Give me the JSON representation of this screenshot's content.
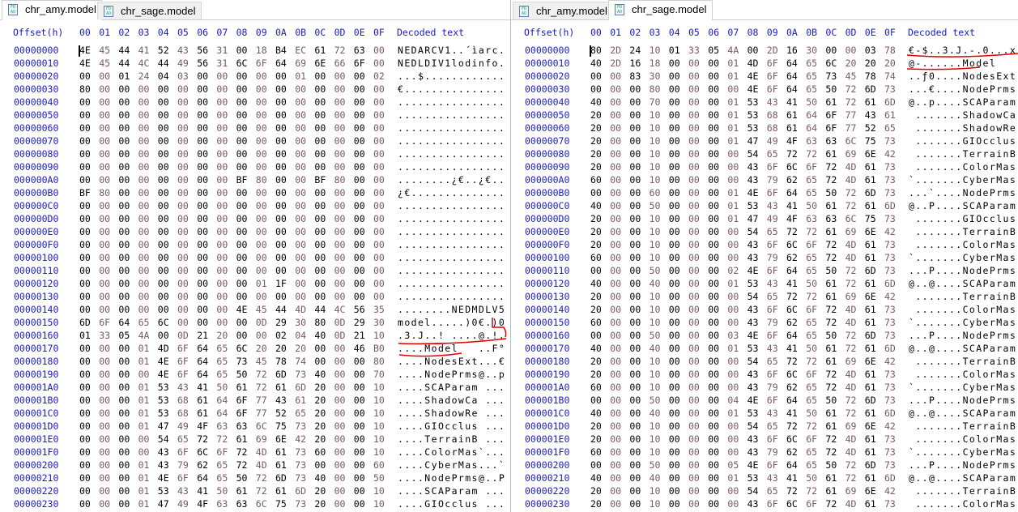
{
  "header": {
    "offset_label": "Offset(h)",
    "columns": [
      "00",
      "01",
      "02",
      "03",
      "04",
      "05",
      "06",
      "07",
      "08",
      "09",
      "0A",
      "0B",
      "0C",
      "0D",
      "0E",
      "0F"
    ],
    "decoded_label": "Decoded text"
  },
  "colors": {
    "offset": "#1a1acc",
    "hex_even": "#000000",
    "hex_odd": "#7a5a5a",
    "annotation": "#e00000"
  },
  "panes": [
    {
      "tabs": [
        {
          "label": "chr_amy.model",
          "active": true,
          "icon": "file-icon"
        },
        {
          "label": "chr_sage.model",
          "active": false,
          "icon": "file-icon"
        }
      ],
      "rows": [
        {
          "offset": "00000000",
          "bytes": "4E 45 44 41 52 43 56 31 00 18 B4 EC 61 72 63 00",
          "text": "NEDARCV1..´ìarc."
        },
        {
          "offset": "00000010",
          "bytes": "4E 45 44 4C 44 49 56 31 6C 6F 64 69 6E 66 6F 00",
          "text": "NEDLDIV1lodinfo."
        },
        {
          "offset": "00000020",
          "bytes": "00 00 01 24 04 03 00 00 00 00 00 01 00 00 00 02",
          "text": "...$............"
        },
        {
          "offset": "00000030",
          "bytes": "80 00 00 00 00 00 00 00 00 00 00 00 00 00 00 00",
          "text": "€..............."
        },
        {
          "offset": "00000040",
          "bytes": "00 00 00 00 00 00 00 00 00 00 00 00 00 00 00 00",
          "text": "................"
        },
        {
          "offset": "00000050",
          "bytes": "00 00 00 00 00 00 00 00 00 00 00 00 00 00 00 00",
          "text": "................"
        },
        {
          "offset": "00000060",
          "bytes": "00 00 00 00 00 00 00 00 00 00 00 00 00 00 00 00",
          "text": "................"
        },
        {
          "offset": "00000070",
          "bytes": "00 00 00 00 00 00 00 00 00 00 00 00 00 00 00 00",
          "text": "................"
        },
        {
          "offset": "00000080",
          "bytes": "00 00 00 00 00 00 00 00 00 00 00 00 00 00 00 00",
          "text": "................"
        },
        {
          "offset": "00000090",
          "bytes": "00 00 00 00 00 00 00 00 00 00 00 00 00 00 00 00",
          "text": "................"
        },
        {
          "offset": "000000A0",
          "bytes": "00 00 00 00 00 00 00 00 BF 80 00 00 BF 80 00 00",
          "text": "........¿€..¿€.."
        },
        {
          "offset": "000000B0",
          "bytes": "BF 80 00 00 00 00 00 00 00 00 00 00 00 00 00 00",
          "text": "¿€.............."
        },
        {
          "offset": "000000C0",
          "bytes": "00 00 00 00 00 00 00 00 00 00 00 00 00 00 00 00",
          "text": "................"
        },
        {
          "offset": "000000D0",
          "bytes": "00 00 00 00 00 00 00 00 00 00 00 00 00 00 00 00",
          "text": "................"
        },
        {
          "offset": "000000E0",
          "bytes": "00 00 00 00 00 00 00 00 00 00 00 00 00 00 00 00",
          "text": "................"
        },
        {
          "offset": "000000F0",
          "bytes": "00 00 00 00 00 00 00 00 00 00 00 00 00 00 00 00",
          "text": "................"
        },
        {
          "offset": "00000100",
          "bytes": "00 00 00 00 00 00 00 00 00 00 00 00 00 00 00 00",
          "text": "................"
        },
        {
          "offset": "00000110",
          "bytes": "00 00 00 00 00 00 00 00 00 00 00 00 00 00 00 00",
          "text": "................"
        },
        {
          "offset": "00000120",
          "bytes": "00 00 00 00 00 00 00 00 00 01 1F 00 00 00 00 00",
          "text": "................"
        },
        {
          "offset": "00000130",
          "bytes": "00 00 00 00 00 00 00 00 00 00 00 00 00 00 00 00",
          "text": "................"
        },
        {
          "offset": "00000140",
          "bytes": "00 00 00 00 00 00 00 00 4E 45 44 4D 44 4C 56 35",
          "text": "........NEDMDLV5"
        },
        {
          "offset": "00000150",
          "bytes": "6D 6F 64 65 6C 00 00 00 00 0D 29 30 80 0D 29 30",
          "text": "model.....)0€.)0"
        },
        {
          "offset": "00000160",
          "bytes": "01 33 05 4A 00 0D 21 20 00 00 02 04 40 0D 21 10",
          "text": ".3.J..! ....@.!."
        },
        {
          "offset": "00000170",
          "bytes": "00 00 00 01 4D 6F 64 65 6C 20 20 20 00 00 46 B0",
          "text": "....Model   ..F°"
        },
        {
          "offset": "00000180",
          "bytes": "00 00 00 01 4E 6F 64 65 73 45 78 74 00 00 00 80",
          "text": "....NodesExt...€"
        },
        {
          "offset": "00000190",
          "bytes": "00 00 00 00 4E 6F 64 65 50 72 6D 73 40 00 00 70",
          "text": "....NodePrms@..p"
        },
        {
          "offset": "000001A0",
          "bytes": "00 00 00 01 53 43 41 50 61 72 61 6D 20 00 00 10",
          "text": "....SCAParam ..."
        },
        {
          "offset": "000001B0",
          "bytes": "00 00 00 01 53 68 61 64 6F 77 43 61 20 00 00 10",
          "text": "....ShadowCa ..."
        },
        {
          "offset": "000001C0",
          "bytes": "00 00 00 01 53 68 61 64 6F 77 52 65 20 00 00 10",
          "text": "....ShadowRe ..."
        },
        {
          "offset": "000001D0",
          "bytes": "00 00 00 01 47 49 4F 63 63 6C 75 73 20 00 00 10",
          "text": "....GIOcclus ..."
        },
        {
          "offset": "000001E0",
          "bytes": "00 00 00 00 54 65 72 72 61 69 6E 42 20 00 00 10",
          "text": "....TerrainB ..."
        },
        {
          "offset": "000001F0",
          "bytes": "00 00 00 00 43 6F 6C 6F 72 4D 61 73 60 00 00 10",
          "text": "....ColorMas`..."
        },
        {
          "offset": "00000200",
          "bytes": "00 00 00 01 43 79 62 65 72 4D 61 73 00 00 00 60",
          "text": "....CyberMas...`"
        },
        {
          "offset": "00000210",
          "bytes": "00 00 00 01 4E 6F 64 65 50 72 6D 73 40 00 00 50",
          "text": "....NodePrms@..P"
        },
        {
          "offset": "00000220",
          "bytes": "00 00 00 01 53 43 41 50 61 72 61 6D 20 00 00 10",
          "text": "....SCAParam ..."
        },
        {
          "offset": "00000230",
          "bytes": "00 00 00 01 47 49 4F 63 63 6C 75 73 20 00 00 10",
          "text": "....GIOcclus ..."
        }
      ]
    },
    {
      "tabs": [
        {
          "label": "chr_amy.model",
          "active": false,
          "icon": "file-icon"
        },
        {
          "label": "chr_sage.model",
          "active": true,
          "icon": "file-icon"
        }
      ],
      "rows": [
        {
          "offset": "00000000",
          "bytes": "80 2D 24 10 01 33 05 4A 00 2D 16 30 00 00 03 78",
          "text": "€-$..3.J.-.0...x"
        },
        {
          "offset": "00000010",
          "bytes": "40 2D 16 18 00 00 00 01 4D 6F 64 65 6C 20 20 20",
          "text": "@-......Model   "
        },
        {
          "offset": "00000020",
          "bytes": "00 00 83 30 00 00 00 01 4E 6F 64 65 73 45 78 74",
          "text": "..ƒ0....NodesExt"
        },
        {
          "offset": "00000030",
          "bytes": "00 00 00 80 00 00 00 00 4E 6F 64 65 50 72 6D 73",
          "text": "...€....NodePrms"
        },
        {
          "offset": "00000040",
          "bytes": "40 00 00 70 00 00 00 01 53 43 41 50 61 72 61 6D",
          "text": "@..p....SCAParam"
        },
        {
          "offset": "00000050",
          "bytes": "20 00 00 10 00 00 00 01 53 68 61 64 6F 77 43 61",
          "text": " .......ShadowCa"
        },
        {
          "offset": "00000060",
          "bytes": "20 00 00 10 00 00 00 01 53 68 61 64 6F 77 52 65",
          "text": " .......ShadowRe"
        },
        {
          "offset": "00000070",
          "bytes": "20 00 00 10 00 00 00 01 47 49 4F 63 63 6C 75 73",
          "text": " .......GIOcclus"
        },
        {
          "offset": "00000080",
          "bytes": "20 00 00 10 00 00 00 00 54 65 72 72 61 69 6E 42",
          "text": " .......TerrainB"
        },
        {
          "offset": "00000090",
          "bytes": "20 00 00 10 00 00 00 00 43 6F 6C 6F 72 4D 61 73",
          "text": " .......ColorMas"
        },
        {
          "offset": "000000A0",
          "bytes": "60 00 00 10 00 00 00 00 43 79 62 65 72 4D 61 73",
          "text": "`.......CyberMas"
        },
        {
          "offset": "000000B0",
          "bytes": "00 00 00 60 00 00 00 01 4E 6F 64 65 50 72 6D 73",
          "text": "...`....NodePrms"
        },
        {
          "offset": "000000C0",
          "bytes": "40 00 00 50 00 00 00 01 53 43 41 50 61 72 61 6D",
          "text": "@..P....SCAParam"
        },
        {
          "offset": "000000D0",
          "bytes": "20 00 00 10 00 00 00 01 47 49 4F 63 63 6C 75 73",
          "text": " .......GIOcclus"
        },
        {
          "offset": "000000E0",
          "bytes": "20 00 00 10 00 00 00 00 54 65 72 72 61 69 6E 42",
          "text": " .......TerrainB"
        },
        {
          "offset": "000000F0",
          "bytes": "20 00 00 10 00 00 00 00 43 6F 6C 6F 72 4D 61 73",
          "text": " .......ColorMas"
        },
        {
          "offset": "00000100",
          "bytes": "60 00 00 10 00 00 00 00 43 79 62 65 72 4D 61 73",
          "text": "`.......CyberMas"
        },
        {
          "offset": "00000110",
          "bytes": "00 00 00 50 00 00 00 02 4E 6F 64 65 50 72 6D 73",
          "text": "...P....NodePrms"
        },
        {
          "offset": "00000120",
          "bytes": "40 00 00 40 00 00 00 01 53 43 41 50 61 72 61 6D",
          "text": "@..@....SCAParam"
        },
        {
          "offset": "00000130",
          "bytes": "20 00 00 10 00 00 00 00 54 65 72 72 61 69 6E 42",
          "text": " .......TerrainB"
        },
        {
          "offset": "00000140",
          "bytes": "20 00 00 10 00 00 00 00 43 6F 6C 6F 72 4D 61 73",
          "text": " .......ColorMas"
        },
        {
          "offset": "00000150",
          "bytes": "60 00 00 10 00 00 00 00 43 79 62 65 72 4D 61 73",
          "text": "`.......CyberMas"
        },
        {
          "offset": "00000160",
          "bytes": "00 00 00 50 00 00 00 03 4E 6F 64 65 50 72 6D 73",
          "text": "...P....NodePrms"
        },
        {
          "offset": "00000170",
          "bytes": "40 00 00 40 00 00 00 01 53 43 41 50 61 72 61 6D",
          "text": "@..@....SCAParam"
        },
        {
          "offset": "00000180",
          "bytes": "20 00 00 10 00 00 00 00 54 65 72 72 61 69 6E 42",
          "text": " .......TerrainB"
        },
        {
          "offset": "00000190",
          "bytes": "20 00 00 10 00 00 00 00 43 6F 6C 6F 72 4D 61 73",
          "text": " .......ColorMas"
        },
        {
          "offset": "000001A0",
          "bytes": "60 00 00 10 00 00 00 00 43 79 62 65 72 4D 61 73",
          "text": "`.......CyberMas"
        },
        {
          "offset": "000001B0",
          "bytes": "00 00 00 50 00 00 00 04 4E 6F 64 65 50 72 6D 73",
          "text": "...P....NodePrms"
        },
        {
          "offset": "000001C0",
          "bytes": "40 00 00 40 00 00 00 01 53 43 41 50 61 72 61 6D",
          "text": "@..@....SCAParam"
        },
        {
          "offset": "000001D0",
          "bytes": "20 00 00 10 00 00 00 00 54 65 72 72 61 69 6E 42",
          "text": " .......TerrainB"
        },
        {
          "offset": "000001E0",
          "bytes": "20 00 00 10 00 00 00 00 43 6F 6C 6F 72 4D 61 73",
          "text": " .......ColorMas"
        },
        {
          "offset": "000001F0",
          "bytes": "60 00 00 10 00 00 00 00 43 79 62 65 72 4D 61 73",
          "text": "`.......CyberMas"
        },
        {
          "offset": "00000200",
          "bytes": "00 00 00 50 00 00 00 05 4E 6F 64 65 50 72 6D 73",
          "text": "...P....NodePrms"
        },
        {
          "offset": "00000210",
          "bytes": "40 00 00 40 00 00 00 01 53 43 41 50 61 72 61 6D",
          "text": "@..@....SCAParam"
        },
        {
          "offset": "00000220",
          "bytes": "20 00 00 10 00 00 00 00 54 65 72 72 61 69 6E 42",
          "text": " .......TerrainB"
        },
        {
          "offset": "00000230",
          "bytes": "20 00 00 10 00 00 00 00 43 6F 6C 6F 72 4D 61 73",
          "text": " .......ColorMas"
        }
      ]
    }
  ]
}
